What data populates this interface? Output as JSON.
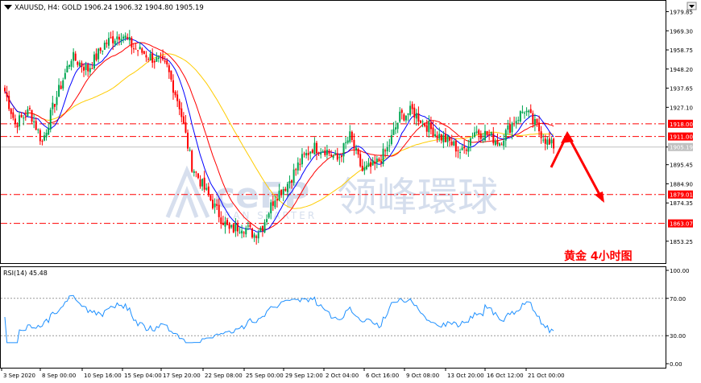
{
  "header": {
    "symbol_line": "XAUUSD, H4:  GOLD  1906.24 1906.32 1904.80 1905.19"
  },
  "annotation_cn": "黄金 4小时图",
  "watermark": {
    "brand": "ceFP",
    "cn": "领峰環球",
    "sub": "BAN  STARTER"
  },
  "colors": {
    "bull": "#00a651",
    "bear": "#ff0000",
    "ma_fast": "#0000ff",
    "ma_mid": "#ff0000",
    "ma_slow": "#ffcc00",
    "rsi": "#1e90ff",
    "level_line": "#ff0000",
    "arrow": "#ff0000",
    "axis_label_bg": "#ff0000"
  },
  "chart_data": [
    {
      "type": "candlestick",
      "ylim": [
        1842.5,
        1984.5
      ],
      "y_ticks": [
        "1979.85",
        "1969.30",
        "1958.75",
        "1948.20",
        "1937.65",
        "1927.10",
        "1905.19",
        "1895.45",
        "1884.90",
        "1874.35",
        "1853.25"
      ],
      "x_tick_labels": [
        "3 Sep 2020",
        "8 Sep 00:00",
        "10 Sep 16:00",
        "15 Sep 04:00",
        "17 Sep 20:00",
        "22 Sep 08:00",
        "25 Sep 00:00",
        "29 Sep 12:00",
        "2 Oct 04:00",
        "6 Oct 16:00",
        "9 Oct 08:00",
        "13 Oct 20:00",
        "16 Oct 12:00",
        "21 Oct 00:00"
      ],
      "last_price": "1905.19",
      "horizontal_levels": [
        {
          "value": 1918.0,
          "label": "1918.00"
        },
        {
          "value": 1911.0,
          "label": "1911.00"
        },
        {
          "value": 1879.01,
          "label": "1879.01"
        },
        {
          "value": 1863.07,
          "label": "1863.07"
        }
      ],
      "anchors": [
        [
          0,
          1936
        ],
        [
          5,
          1918
        ],
        [
          12,
          1925
        ],
        [
          18,
          1908
        ],
        [
          24,
          1930
        ],
        [
          32,
          1955
        ],
        [
          40,
          1948
        ],
        [
          48,
          1962
        ],
        [
          56,
          1968
        ],
        [
          62,
          1960
        ],
        [
          70,
          1955
        ],
        [
          78,
          1949
        ],
        [
          84,
          1928
        ],
        [
          90,
          1895
        ],
        [
          96,
          1882
        ],
        [
          102,
          1870
        ],
        [
          108,
          1859
        ],
        [
          114,
          1862
        ],
        [
          120,
          1857
        ],
        [
          124,
          1862
        ],
        [
          130,
          1878
        ],
        [
          136,
          1885
        ],
        [
          142,
          1897
        ],
        [
          148,
          1905
        ],
        [
          154,
          1904
        ],
        [
          160,
          1898
        ],
        [
          166,
          1911
        ],
        [
          172,
          1892
        ],
        [
          178,
          1895
        ],
        [
          184,
          1904
        ],
        [
          190,
          1922
        ],
        [
          196,
          1925
        ],
        [
          202,
          1918
        ],
        [
          208,
          1912
        ],
        [
          214,
          1908
        ],
        [
          220,
          1902
        ],
        [
          226,
          1914
        ],
        [
          232,
          1912
        ],
        [
          238,
          1908
        ],
        [
          244,
          1918
        ],
        [
          250,
          1926
        ],
        [
          254,
          1919
        ],
        [
          258,
          1913
        ],
        [
          262,
          1906
        ]
      ],
      "sma_periods": {
        "fast": 10,
        "mid": 20,
        "slow": 50
      }
    },
    {
      "type": "line",
      "title": "RSI(14) 45.48",
      "ylim": [
        0,
        100
      ],
      "y_ticks": [
        "100.00",
        "70.00",
        "30.00",
        "0.00"
      ],
      "levels": [
        70,
        30
      ]
    }
  ]
}
